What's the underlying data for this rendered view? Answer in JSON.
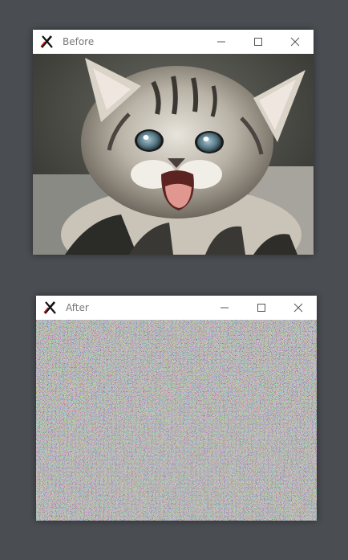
{
  "windows": [
    {
      "title": "Before",
      "app_icon": "x-logo-icon",
      "controls": [
        "minimize-icon",
        "maximize-icon",
        "close-icon"
      ],
      "content": "kitten-photo"
    },
    {
      "title": "After",
      "app_icon": "x-logo-icon",
      "controls": [
        "minimize-icon",
        "maximize-icon",
        "close-icon"
      ],
      "content": "random-noise-image"
    }
  ],
  "colors": {
    "desktop_background": "#4a4e52",
    "titlebar_background": "#ffffff",
    "title_text": "#777777"
  }
}
